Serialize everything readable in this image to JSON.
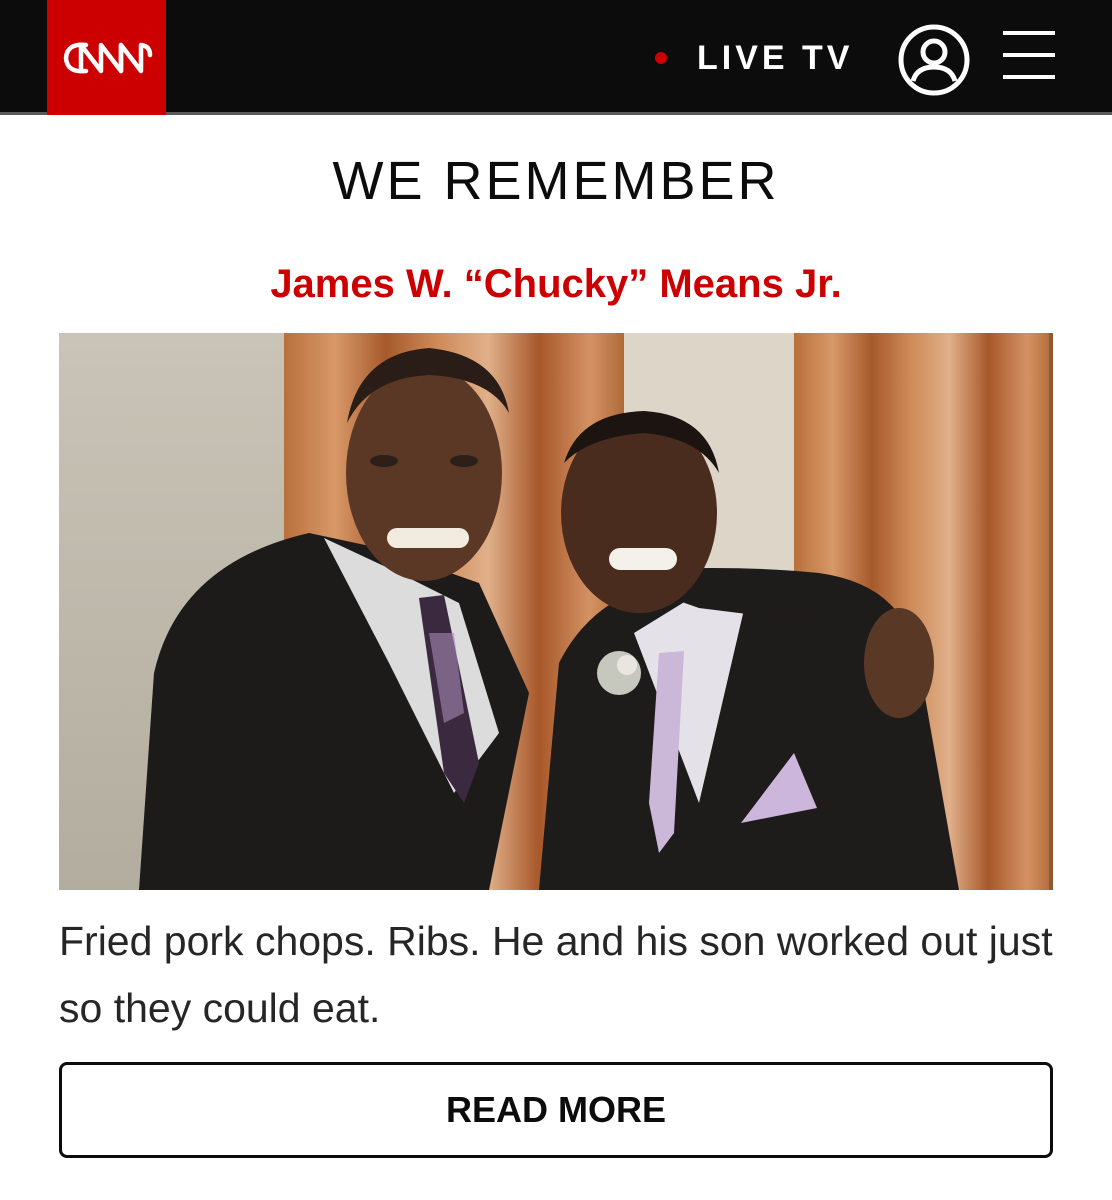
{
  "header": {
    "logo_text": "CNN",
    "live_label": "LIVE TV",
    "user_icon": "user-account-icon",
    "menu_icon": "hamburger-menu-icon"
  },
  "colors": {
    "brand_red": "#cc0000",
    "header_bg": "#0c0c0c",
    "text_dark": "#262626"
  },
  "article": {
    "section_title": "WE REMEMBER",
    "person_name": "James W. “Chucky” Means Jr.",
    "blurb": "Fried pork chops. Ribs. He and his son worked out just so they could eat.",
    "read_more_label": "READ MORE"
  }
}
